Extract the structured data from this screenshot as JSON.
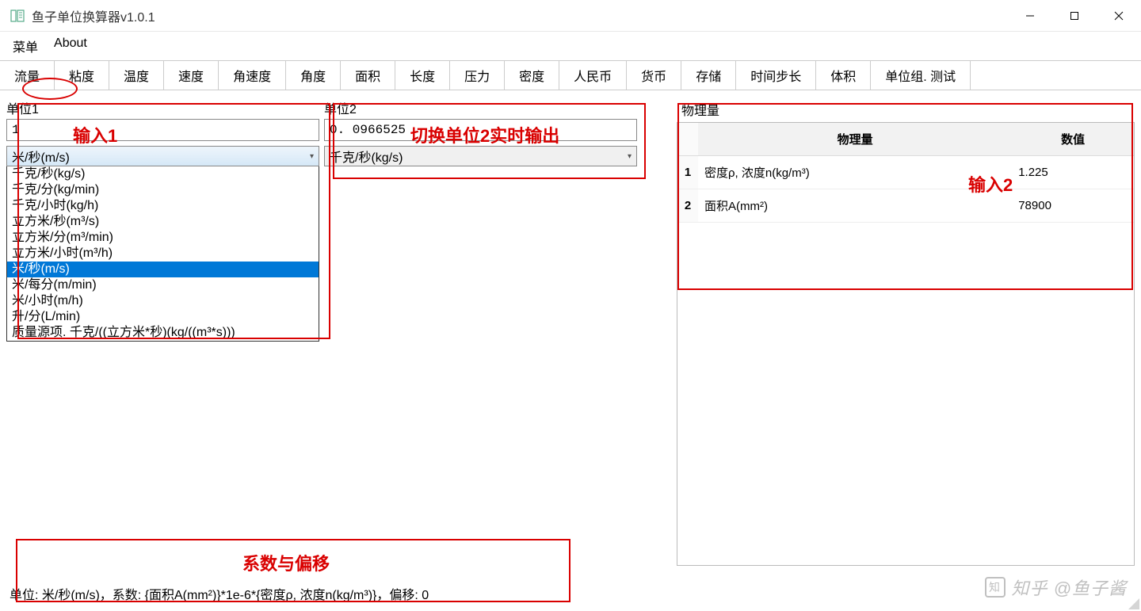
{
  "window": {
    "title": "鱼子单位换算器v1.0.1"
  },
  "menu": {
    "items": [
      "菜单",
      "About"
    ]
  },
  "tabs": [
    "流量",
    "粘度",
    "温度",
    "速度",
    "角速度",
    "角度",
    "面积",
    "长度",
    "压力",
    "密度",
    "人民币",
    "货币",
    "存储",
    "时间步长",
    "体积",
    "单位组. 测试"
  ],
  "active_tab": 0,
  "unit1": {
    "label": "单位1",
    "value": "1",
    "selected": "米/秒(m/s)",
    "options": [
      "千克/秒(kg/s)",
      "千克/分(kg/min)",
      "千克/小时(kg/h)",
      "立方米/秒(m³/s)",
      "立方米/分(m³/min)",
      "立方米/小时(m³/h)",
      "米/秒(m/s)",
      "米/每分(m/min)",
      "米/小时(m/h)",
      "升/分(L/min)",
      "质量源项. 千克/((立方米*秒)(kg/((m³*s)))"
    ],
    "highlight_index": 6
  },
  "unit2": {
    "label": "单位2",
    "value": "0. 0966525",
    "selected": "千克/秒(kg/s)"
  },
  "phys": {
    "label": "物理量",
    "headers": [
      "物理量",
      "数值"
    ],
    "rows": [
      {
        "idx": "1",
        "name": "密度ρ, 浓度n(kg/m³)",
        "value": "1.225"
      },
      {
        "idx": "2",
        "name": "面积A(mm²)",
        "value": "78900"
      }
    ]
  },
  "footer": {
    "status": "单位: 米/秒(m/s)，系数: {面积A(mm²)}*1e-6*{密度ρ, 浓度n(kg/m³)}，偏移: 0"
  },
  "annotations": {
    "input1": "输入1",
    "switch_out": "切换单位2实时输出",
    "coeff": "系数与偏移",
    "input2": "输入2"
  },
  "watermark": "知乎 @鱼子酱"
}
